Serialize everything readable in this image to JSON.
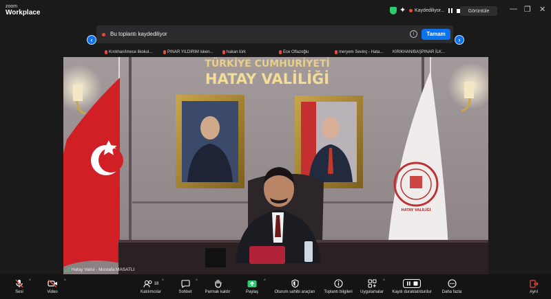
{
  "app": {
    "logo_line1": "zoom",
    "logo_line2": "Workplace"
  },
  "titlebar": {
    "recording_status": "Kaydediliyor...",
    "view_label": "Görüntüle",
    "controls": [
      "—",
      "❐",
      "✕"
    ]
  },
  "banner": {
    "message": "Bu toplantı kaydediliyor",
    "ok_label": "Tamam"
  },
  "thumbnails": [
    {
      "name": "Kırıkhan/imece ilkokul..."
    },
    {
      "name": "PINAR YILDIRIM isken..."
    },
    {
      "name": "hakan türk"
    },
    {
      "name": "Ece Oflazoğlu"
    },
    {
      "name": "meryem Sevinç - Hata..."
    },
    {
      "name": "KIRIKHAN/BAŞPINAR İLK..."
    }
  ],
  "video": {
    "sign_line1": "TÜRKİYE CUMHURİYETİ",
    "sign_line2": "HATAY VALİLİĞİ",
    "speaker_label": "Hatay Valisi - Mustafa MASATLI",
    "seal_text": "HATAY VALİLİĞİ"
  },
  "toolbar": {
    "mute": "Sesi",
    "video": "Video",
    "participants": "Katılımcılar",
    "participants_count": "18",
    "chat": "Sohbet",
    "raise_hand": "Parmak kaldır",
    "share": "Paylaş",
    "host_tools": "Oturum sahibi araçları",
    "meeting_info": "Toplantı bilgileri",
    "apps": "Uygulamalar",
    "record": "Kaydı duraklat/durdur",
    "more": "Daha fazla",
    "leave": "Ayrıl"
  },
  "colors": {
    "accent": "#0e72ed",
    "alert": "#e74c3c",
    "ok": "#2ecc71"
  }
}
